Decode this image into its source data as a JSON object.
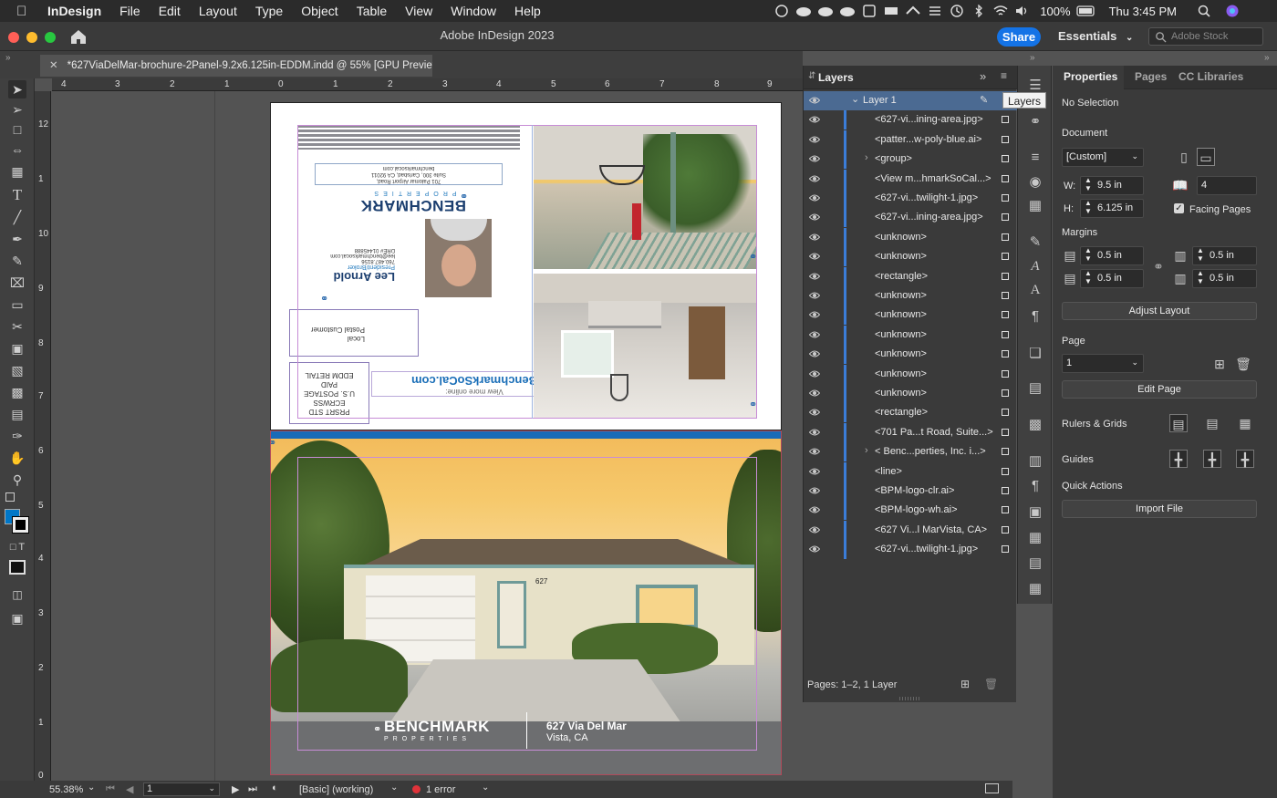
{
  "menubar": {
    "app_name": "InDesign",
    "items": [
      "File",
      "Edit",
      "Layout",
      "Type",
      "Object",
      "Table",
      "View",
      "Window",
      "Help"
    ],
    "battery": "100%",
    "clock": "Thu 3:45 PM"
  },
  "appbar": {
    "title": "Adobe InDesign 2023",
    "share_label": "Share",
    "workspace_label": "Essentials",
    "stock_placeholder": "Adobe Stock"
  },
  "document_tab": {
    "label": "*627ViaDelMar-brochure-2Panel-9.2x6.125in-EDDM.indd @ 55% [GPU Preview]"
  },
  "rulers": {
    "horizontal": [
      "4",
      "3",
      "2",
      "1",
      "0",
      "1",
      "2",
      "3",
      "4",
      "5",
      "6",
      "7",
      "8",
      "9"
    ],
    "vertical": [
      "12",
      "1",
      "10",
      "9",
      "8",
      "7",
      "6",
      "5",
      "4",
      "3",
      "2",
      "1",
      "0"
    ]
  },
  "page_top": {
    "company_url": "BenchmarkSoCal.com",
    "view_more": "View more online:",
    "agent_name": "Lee Arnold",
    "agent_title": "President/Broker",
    "agent_phone": "760.487.8156",
    "agent_email": "lee@benchmarksocal.com",
    "agent_dre": "DRE# 01445888",
    "address_line1": "701 Palomar Airport Road,",
    "address_line2": "Suite 300, Carlsbad, CA 92011",
    "address_line3": "benchmarksocal.com",
    "postal_line1": "Local",
    "postal_line2": "Postal Customer",
    "postage_lines": [
      "PRSRT STD",
      "ECRWSS",
      "U.S. POSTAGE",
      "PAID",
      "EDDM RETAIL"
    ]
  },
  "page_bottom": {
    "logo_text": "BENCHMARK",
    "logo_sub": "PROPERTIES",
    "property_address": "627 Via Del Mar",
    "property_city": "Vista, CA",
    "house_number": "627"
  },
  "status": {
    "zoom": "55.38%",
    "page": "1",
    "preflight_profile": "[Basic] (working)",
    "errors": "1 error"
  },
  "layers_panel": {
    "title": "Layers",
    "tooltip": "Layers",
    "layer_name": "Layer 1",
    "items": [
      {
        "name": "<627-vi...ining-area.jpg>",
        "expandable": false
      },
      {
        "name": "<patter...w-poly-blue.ai>",
        "expandable": false
      },
      {
        "name": "<group>",
        "expandable": true
      },
      {
        "name": "<View m...hmarkSoCal...>",
        "expandable": false
      },
      {
        "name": "<627-vi...twilight-1.jpg>",
        "expandable": false
      },
      {
        "name": "<627-vi...ining-area.jpg>",
        "expandable": false
      },
      {
        "name": "<unknown>",
        "expandable": false
      },
      {
        "name": "<unknown>",
        "expandable": false
      },
      {
        "name": "<rectangle>",
        "expandable": false
      },
      {
        "name": "<unknown>",
        "expandable": false
      },
      {
        "name": "<unknown>",
        "expandable": false
      },
      {
        "name": "<unknown>",
        "expandable": false
      },
      {
        "name": "<unknown>",
        "expandable": false
      },
      {
        "name": "<unknown>",
        "expandable": false
      },
      {
        "name": "<unknown>",
        "expandable": false
      },
      {
        "name": "<rectangle>",
        "expandable": false
      },
      {
        "name": "<701 Pa...t Road, Suite...>",
        "expandable": false
      },
      {
        "name": "< Benc...perties, Inc. i...>",
        "expandable": true
      },
      {
        "name": "<line>",
        "expandable": false
      },
      {
        "name": "<BPM-logo-clr.ai>",
        "expandable": false
      },
      {
        "name": "<BPM-logo-wh.ai>",
        "expandable": false
      },
      {
        "name": "<627 Vi...l MarVista, CA>",
        "expandable": false
      },
      {
        "name": "<627-vi...twilight-1.jpg>",
        "expandable": false
      }
    ],
    "footer": "Pages: 1–2, 1 Layer"
  },
  "properties_panel": {
    "tabs": [
      "Properties",
      "Pages",
      "CC Libraries"
    ],
    "selection": "No Selection",
    "document_heading": "Document",
    "preset": "[Custom]",
    "width_label": "W:",
    "width": "9.5 in",
    "height_label": "H:",
    "height": "6.125 in",
    "pages_count": "4",
    "facing_pages_label": "Facing Pages",
    "facing_pages_checked": true,
    "margins_heading": "Margins",
    "margin_top": "0.5 in",
    "margin_bottom": "0.5 in",
    "margin_left": "0.5 in",
    "margin_right": "0.5 in",
    "adjust_layout_label": "Adjust Layout",
    "page_heading": "Page",
    "page_value": "1",
    "edit_page_label": "Edit Page",
    "rulers_grids_label": "Rulers & Grids",
    "guides_label": "Guides",
    "quick_actions_label": "Quick Actions",
    "import_file_label": "Import File"
  },
  "colors": {
    "accent": "#1473e6",
    "brand_blue": "#1a6bb8",
    "selection_row": "#4b6a92"
  }
}
